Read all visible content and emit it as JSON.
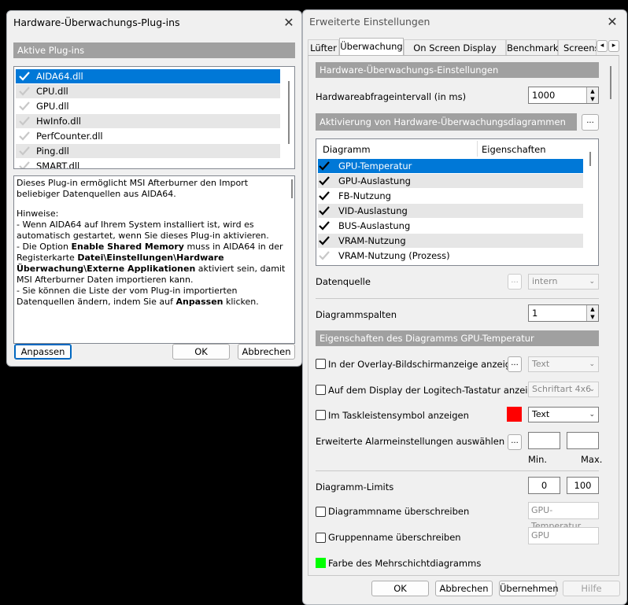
{
  "plugins_dialog": {
    "title": "Hardware-Überwachungs-Plug-ins",
    "section": "Aktive Plug-ins",
    "plugins": [
      {
        "name": "AIDA64.dll",
        "checked": true,
        "selected": true
      },
      {
        "name": "CPU.dll",
        "checked": false
      },
      {
        "name": "GPU.dll",
        "checked": false
      },
      {
        "name": "HwInfo.dll",
        "checked": false
      },
      {
        "name": "PerfCounter.dll",
        "checked": false
      },
      {
        "name": "Ping.dll",
        "checked": false
      },
      {
        "name": "SMART.dll",
        "checked": false
      }
    ],
    "desc_intro": "Dieses Plug-in ermöglicht MSI Afterburner den Import beliebiger Datenquellen aus AIDA64.",
    "desc_hints_title": "Hinweise:",
    "desc_hint1": "- Wenn AIDA64 auf Ihrem System installiert ist, wird es automatisch gestartet, wenn Sie dieses Plug-in aktivieren.",
    "desc_hint2_a": "- Die Option ",
    "desc_hint2_b": "Enable Shared Memory",
    "desc_hint2_c": " muss in AIDA64 in der Registerkarte ",
    "desc_hint2_d": "Datei\\Einstellungen\\Hardware Überwachung\\Externe Applikationen",
    "desc_hint2_e": " aktiviert sein, damit MSI Afterburner Daten importieren kann.",
    "desc_hint3_a": "- Sie können die Liste der vom Plug-in importierten Datenquellen ändern, indem Sie auf ",
    "desc_hint3_b": "Anpassen",
    "desc_hint3_c": " klicken.",
    "btn_customize": "Anpassen",
    "btn_ok": "OK",
    "btn_cancel": "Abbrechen",
    "close": "✕"
  },
  "settings_dialog": {
    "title": "Erweiterte Einstellungen",
    "close": "✕",
    "tabs": [
      "Lüfter",
      "Überwachung",
      "On Screen Display (OSD)",
      "Benchmark",
      "Screens"
    ],
    "tab_prev": "◂",
    "tab_next": "▸",
    "sec_hw_settings": "Hardware-Überwachungs-Einstellungen",
    "poll_label": "Hardwareabfrageintervall (in ms)",
    "poll_value": "1000",
    "sec_activation": "Aktivierung von Hardware-Überwachungsdiagrammen",
    "activation_btn": "...",
    "col_graph": "Diagramm",
    "col_props": "Eigenschaften",
    "graphs": [
      {
        "name": "GPU-Temperatur",
        "checked": true,
        "selected": true
      },
      {
        "name": "GPU-Auslastung",
        "checked": true
      },
      {
        "name": "FB-Nutzung",
        "checked": true
      },
      {
        "name": "VID-Auslastung",
        "checked": true
      },
      {
        "name": "BUS-Auslastung",
        "checked": true
      },
      {
        "name": "VRAM-Nutzung",
        "checked": true
      },
      {
        "name": "VRAM-Nutzung (Prozess)",
        "checked": false
      }
    ],
    "datasource_label": "Datenquelle",
    "datasource_btn": "...",
    "datasource_value": "intern",
    "columns_label": "Diagrammspalten",
    "columns_value": "1",
    "sec_properties": "Eigenschaften des Diagramms GPU-Temperatur",
    "osd_label": "In der Overlay-Bildschirmanzeige anzeigen",
    "osd_btn": "...",
    "osd_value": "Text",
    "logitech_label": "Auf dem Display der Logitech-Tastatur anzeigen",
    "logitech_value": "Schriftart 4x6",
    "tray_label": "Im Taskleistensymbol anzeigen",
    "tray_color": "#ff0000",
    "tray_value": "Text",
    "alarm_label": "Erweiterte Alarmeinstellungen auswählen",
    "alarm_btn": "...",
    "min_label": "Min.",
    "max_label": "Max.",
    "limits_label": "Diagramm-Limits",
    "limit_min": "0",
    "limit_max": "100",
    "override_graph_label": "Diagrammname überschreiben",
    "override_graph_value": "GPU-Temperatur",
    "override_group_label": "Gruppenname überschreiben",
    "override_group_value": "GPU",
    "layer_color": "#00ff00",
    "layer_label": "Farbe des Mehrschichtdiagramms",
    "btn_ok": "OK",
    "btn_cancel": "Abbrechen",
    "btn_apply": "Übernehmen",
    "btn_help": "Hilfe"
  }
}
